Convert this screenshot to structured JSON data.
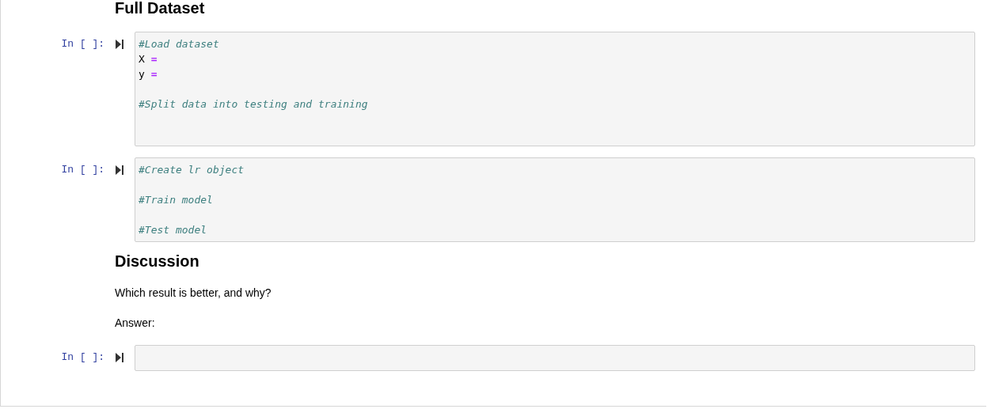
{
  "cells": [
    {
      "kind": "heading",
      "text": "Full Dataset"
    },
    {
      "kind": "code",
      "prompt": "In [ ]:",
      "lines": [
        {
          "kind": "code",
          "tokens": [
            {
              "kind": "comment",
              "text": "#Load dataset"
            }
          ]
        },
        {
          "kind": "code",
          "tokens": [
            {
              "kind": "name",
              "text": "X"
            },
            {
              "kind": "operator",
              "text": "="
            }
          ]
        },
        {
          "kind": "code",
          "tokens": [
            {
              "kind": "name",
              "text": "y"
            },
            {
              "kind": "operator",
              "text": "="
            }
          ]
        },
        {
          "kind": "blank"
        },
        {
          "kind": "code",
          "tokens": [
            {
              "kind": "comment",
              "text": "#Split data into testing and training"
            }
          ]
        },
        {
          "kind": "blank"
        },
        {
          "kind": "blank"
        }
      ]
    },
    {
      "kind": "code",
      "prompt": "In [ ]:",
      "lines": [
        {
          "kind": "code",
          "tokens": [
            {
              "kind": "comment",
              "text": "#Create lr object"
            }
          ]
        },
        {
          "kind": "blank"
        },
        {
          "kind": "code",
          "tokens": [
            {
              "kind": "comment",
              "text": "#Train model"
            }
          ]
        },
        {
          "kind": "blank"
        },
        {
          "kind": "code",
          "tokens": [
            {
              "kind": "comment",
              "text": "#Test model"
            }
          ]
        }
      ]
    },
    {
      "kind": "heading",
      "text": "Discussion"
    },
    {
      "kind": "paragraph",
      "text": "Which result is better, and why?"
    },
    {
      "kind": "paragraph",
      "text": "Answer:"
    },
    {
      "kind": "code",
      "prompt": "In [ ]:"
    }
  ]
}
